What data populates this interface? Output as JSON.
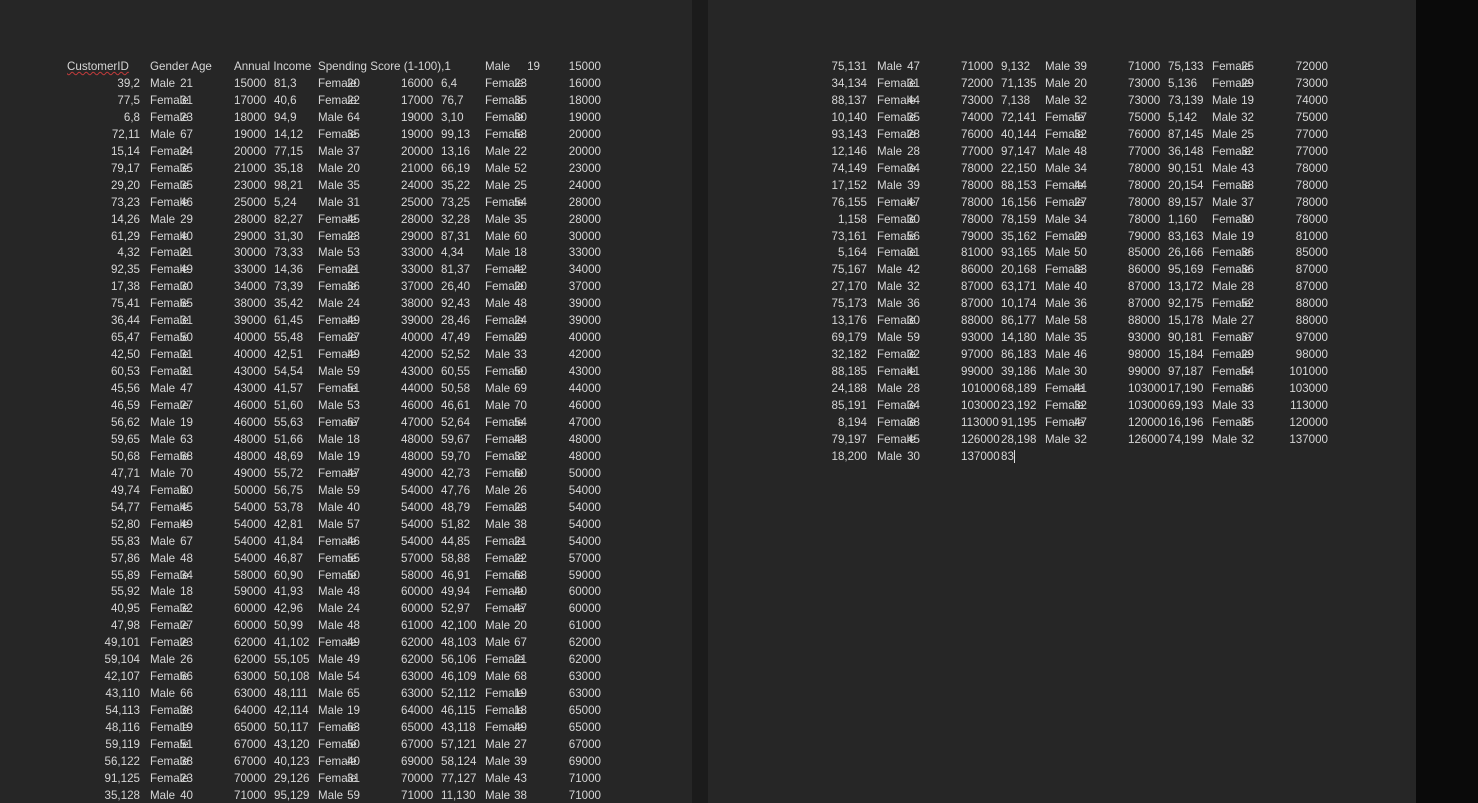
{
  "page1": {
    "header": [
      "CustomerID",
      "Gender Age",
      "Annual Income",
      "Spending Score (1-100),1",
      "Male",
      "19",
      "15000"
    ],
    "rows": [
      [
        "39,2",
        "Male",
        "21",
        "15000",
        "81,3",
        "Female",
        "20",
        "16000",
        "6,4",
        "Female",
        "23",
        "16000"
      ],
      [
        "77,5",
        "Female",
        "31",
        "17000",
        "40,6",
        "Female",
        "22",
        "17000",
        "76,7",
        "Female",
        "35",
        "18000"
      ],
      [
        "6,8",
        "Female",
        "23",
        "18000",
        "94,9",
        "Male",
        "64",
        "19000",
        "3,10",
        "Female",
        "30",
        "19000"
      ],
      [
        "72,11",
        "Male",
        "67",
        "19000",
        "14,12",
        "Female",
        "35",
        "19000",
        "99,13",
        "Female",
        "58",
        "20000"
      ],
      [
        "15,14",
        "Female",
        "24",
        "20000",
        "77,15",
        "Male",
        "37",
        "20000",
        "13,16",
        "Male",
        "22",
        "20000"
      ],
      [
        "79,17",
        "Female",
        "35",
        "21000",
        "35,18",
        "Male",
        "20",
        "21000",
        "66,19",
        "Male",
        "52",
        "23000"
      ],
      [
        "29,20",
        "Female",
        "35",
        "23000",
        "98,21",
        "Male",
        "35",
        "24000",
        "35,22",
        "Male",
        "25",
        "24000"
      ],
      [
        "73,23",
        "Female",
        "46",
        "25000",
        "5,24",
        "Male",
        "31",
        "25000",
        "73,25",
        "Female",
        "54",
        "28000"
      ],
      [
        "14,26",
        "Male",
        "29",
        "28000",
        "82,27",
        "Female",
        "45",
        "28000",
        "32,28",
        "Male",
        "35",
        "28000"
      ],
      [
        "61,29",
        "Female",
        "40",
        "29000",
        "31,30",
        "Female",
        "23",
        "29000",
        "87,31",
        "Male",
        "60",
        "30000"
      ],
      [
        "4,32",
        "Female",
        "21",
        "30000",
        "73,33",
        "Male",
        "53",
        "33000",
        "4,34",
        "Male",
        "18",
        "33000"
      ],
      [
        "92,35",
        "Female",
        "49",
        "33000",
        "14,36",
        "Female",
        "21",
        "33000",
        "81,37",
        "Female",
        "42",
        "34000"
      ],
      [
        "17,38",
        "Female",
        "30",
        "34000",
        "73,39",
        "Female",
        "36",
        "37000",
        "26,40",
        "Female",
        "20",
        "37000"
      ],
      [
        "75,41",
        "Female",
        "65",
        "38000",
        "35,42",
        "Male",
        "24",
        "38000",
        "92,43",
        "Male",
        "48",
        "39000"
      ],
      [
        "36,44",
        "Female",
        "31",
        "39000",
        "61,45",
        "Female",
        "49",
        "39000",
        "28,46",
        "Female",
        "24",
        "39000"
      ],
      [
        "65,47",
        "Female",
        "50",
        "40000",
        "55,48",
        "Female",
        "27",
        "40000",
        "47,49",
        "Female",
        "29",
        "40000"
      ],
      [
        "42,50",
        "Female",
        "31",
        "40000",
        "42,51",
        "Female",
        "49",
        "42000",
        "52,52",
        "Male",
        "33",
        "42000"
      ],
      [
        "60,53",
        "Female",
        "31",
        "43000",
        "54,54",
        "Male",
        "59",
        "43000",
        "60,55",
        "Female",
        "50",
        "43000"
      ],
      [
        "45,56",
        "Male",
        "47",
        "43000",
        "41,57",
        "Female",
        "51",
        "44000",
        "50,58",
        "Male",
        "69",
        "44000"
      ],
      [
        "46,59",
        "Female",
        "27",
        "46000",
        "51,60",
        "Male",
        "53",
        "46000",
        "46,61",
        "Male",
        "70",
        "46000"
      ],
      [
        "56,62",
        "Male",
        "19",
        "46000",
        "55,63",
        "Female",
        "67",
        "47000",
        "52,64",
        "Female",
        "54",
        "47000"
      ],
      [
        "59,65",
        "Male",
        "63",
        "48000",
        "51,66",
        "Male",
        "18",
        "48000",
        "59,67",
        "Female",
        "43",
        "48000"
      ],
      [
        "50,68",
        "Female",
        "68",
        "48000",
        "48,69",
        "Male",
        "19",
        "48000",
        "59,70",
        "Female",
        "32",
        "48000"
      ],
      [
        "47,71",
        "Male",
        "70",
        "49000",
        "55,72",
        "Female",
        "47",
        "49000",
        "42,73",
        "Female",
        "60",
        "50000"
      ],
      [
        "49,74",
        "Female",
        "60",
        "50000",
        "56,75",
        "Male",
        "59",
        "54000",
        "47,76",
        "Male",
        "26",
        "54000"
      ],
      [
        "54,77",
        "Female",
        "45",
        "54000",
        "53,78",
        "Male",
        "40",
        "54000",
        "48,79",
        "Female",
        "23",
        "54000"
      ],
      [
        "52,80",
        "Female",
        "49",
        "54000",
        "42,81",
        "Male",
        "57",
        "54000",
        "51,82",
        "Male",
        "38",
        "54000"
      ],
      [
        "55,83",
        "Male",
        "67",
        "54000",
        "41,84",
        "Female",
        "46",
        "54000",
        "44,85",
        "Female",
        "21",
        "54000"
      ],
      [
        "57,86",
        "Male",
        "48",
        "54000",
        "46,87",
        "Female",
        "55",
        "57000",
        "58,88",
        "Female",
        "22",
        "57000"
      ],
      [
        "55,89",
        "Female",
        "34",
        "58000",
        "60,90",
        "Female",
        "50",
        "58000",
        "46,91",
        "Female",
        "68",
        "59000"
      ],
      [
        "55,92",
        "Male",
        "18",
        "59000",
        "41,93",
        "Male",
        "48",
        "60000",
        "49,94",
        "Female",
        "40",
        "60000"
      ],
      [
        "40,95",
        "Female",
        "32",
        "60000",
        "42,96",
        "Male",
        "24",
        "60000",
        "52,97",
        "Female",
        "47",
        "60000"
      ],
      [
        "47,98",
        "Female",
        "27",
        "60000",
        "50,99",
        "Male",
        "48",
        "61000",
        "42,100",
        "Male",
        "20",
        "61000"
      ],
      [
        "49,101",
        "Female",
        "23",
        "62000",
        "41,102",
        "Female",
        "49",
        "62000",
        "48,103",
        "Male",
        "67",
        "62000"
      ],
      [
        "59,104",
        "Male",
        "26",
        "62000",
        "55,105",
        "Male",
        "49",
        "62000",
        "56,106",
        "Female",
        "21",
        "62000"
      ],
      [
        "42,107",
        "Female",
        "66",
        "63000",
        "50,108",
        "Male",
        "54",
        "63000",
        "46,109",
        "Male",
        "68",
        "63000"
      ],
      [
        "43,110",
        "Male",
        "66",
        "63000",
        "48,111",
        "Male",
        "65",
        "63000",
        "52,112",
        "Female",
        "19",
        "63000"
      ],
      [
        "54,113",
        "Female",
        "38",
        "64000",
        "42,114",
        "Male",
        "19",
        "64000",
        "46,115",
        "Female",
        "18",
        "65000"
      ],
      [
        "48,116",
        "Female",
        "19",
        "65000",
        "50,117",
        "Female",
        "63",
        "65000",
        "43,118",
        "Female",
        "49",
        "65000"
      ],
      [
        "59,119",
        "Female",
        "51",
        "67000",
        "43,120",
        "Female",
        "50",
        "67000",
        "57,121",
        "Male",
        "27",
        "67000"
      ],
      [
        "56,122",
        "Female",
        "38",
        "67000",
        "40,123",
        "Female",
        "40",
        "69000",
        "58,124",
        "Male",
        "39",
        "69000"
      ],
      [
        "91,125",
        "Female",
        "23",
        "70000",
        "29,126",
        "Female",
        "31",
        "70000",
        "77,127",
        "Male",
        "43",
        "71000"
      ],
      [
        "35,128",
        "Male",
        "40",
        "71000",
        "95,129",
        "Male",
        "59",
        "71000",
        "11,130",
        "Male",
        "38",
        "71000"
      ]
    ]
  },
  "page2": {
    "rows": [
      [
        "75,131",
        "Male",
        "47",
        "71000",
        "9,132",
        "Male",
        "39",
        "71000",
        "75,133",
        "Female",
        "25",
        "72000"
      ],
      [
        "34,134",
        "Female",
        "31",
        "72000",
        "71,135",
        "Male",
        "20",
        "73000",
        "5,136",
        "Female",
        "29",
        "73000"
      ],
      [
        "88,137",
        "Female",
        "44",
        "73000",
        "7,138",
        "Male",
        "32",
        "73000",
        "73,139",
        "Male",
        "19",
        "74000"
      ],
      [
        "10,140",
        "Female",
        "35",
        "74000",
        "72,141",
        "Female",
        "57",
        "75000",
        "5,142",
        "Male",
        "32",
        "75000"
      ],
      [
        "93,143",
        "Female",
        "28",
        "76000",
        "40,144",
        "Female",
        "32",
        "76000",
        "87,145",
        "Male",
        "25",
        "77000"
      ],
      [
        "12,146",
        "Male",
        "28",
        "77000",
        "97,147",
        "Male",
        "48",
        "77000",
        "36,148",
        "Female",
        "32",
        "77000"
      ],
      [
        "74,149",
        "Female",
        "34",
        "78000",
        "22,150",
        "Male",
        "34",
        "78000",
        "90,151",
        "Male",
        "43",
        "78000"
      ],
      [
        "17,152",
        "Male",
        "39",
        "78000",
        "88,153",
        "Female",
        "44",
        "78000",
        "20,154",
        "Female",
        "38",
        "78000"
      ],
      [
        "76,155",
        "Female",
        "47",
        "78000",
        "16,156",
        "Female",
        "27",
        "78000",
        "89,157",
        "Male",
        "37",
        "78000"
      ],
      [
        "1,158",
        "Female",
        "30",
        "78000",
        "78,159",
        "Male",
        "34",
        "78000",
        "1,160",
        "Female",
        "30",
        "78000"
      ],
      [
        "73,161",
        "Female",
        "56",
        "79000",
        "35,162",
        "Female",
        "29",
        "79000",
        "83,163",
        "Male",
        "19",
        "81000"
      ],
      [
        "5,164",
        "Female",
        "31",
        "81000",
        "93,165",
        "Male",
        "50",
        "85000",
        "26,166",
        "Female",
        "36",
        "85000"
      ],
      [
        "75,167",
        "Male",
        "42",
        "86000",
        "20,168",
        "Female",
        "33",
        "86000",
        "95,169",
        "Female",
        "36",
        "87000"
      ],
      [
        "27,170",
        "Male",
        "32",
        "87000",
        "63,171",
        "Male",
        "40",
        "87000",
        "13,172",
        "Male",
        "28",
        "87000"
      ],
      [
        "75,173",
        "Male",
        "36",
        "87000",
        "10,174",
        "Male",
        "36",
        "87000",
        "92,175",
        "Female",
        "52",
        "88000"
      ],
      [
        "13,176",
        "Female",
        "30",
        "88000",
        "86,177",
        "Male",
        "58",
        "88000",
        "15,178",
        "Male",
        "27",
        "88000"
      ],
      [
        "69,179",
        "Male",
        "59",
        "93000",
        "14,180",
        "Male",
        "35",
        "93000",
        "90,181",
        "Female",
        "37",
        "97000"
      ],
      [
        "32,182",
        "Female",
        "32",
        "97000",
        "86,183",
        "Male",
        "46",
        "98000",
        "15,184",
        "Female",
        "29",
        "98000"
      ],
      [
        "88,185",
        "Female",
        "41",
        "99000",
        "39,186",
        "Male",
        "30",
        "99000",
        "97,187",
        "Female",
        "54",
        "101000"
      ],
      [
        "24,188",
        "Male",
        "28",
        "101000",
        "68,189",
        "Female",
        "41",
        "103000",
        "17,190",
        "Female",
        "36",
        "103000"
      ],
      [
        "85,191",
        "Female",
        "34",
        "103000",
        "23,192",
        "Female",
        "32",
        "103000",
        "69,193",
        "Male",
        "33",
        "113000"
      ],
      [
        "8,194",
        "Female",
        "38",
        "113000",
        "91,195",
        "Female",
        "47",
        "120000",
        "16,196",
        "Female",
        "35",
        "120000"
      ],
      [
        "79,197",
        "Female",
        "45",
        "126000",
        "28,198",
        "Male",
        "32",
        "126000",
        "74,199",
        "Male",
        "32",
        "137000"
      ],
      [
        "18,200",
        "Male",
        "30",
        "137000",
        "83"
      ]
    ]
  }
}
